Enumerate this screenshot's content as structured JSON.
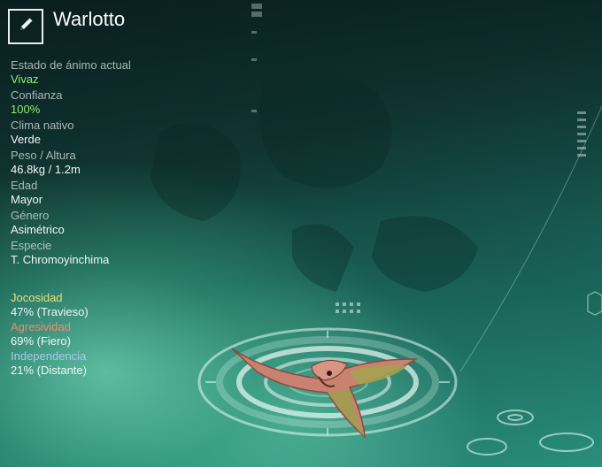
{
  "creature": {
    "name": "Warlotto"
  },
  "stats": [
    {
      "label": "Estado de ánimo actual",
      "value": "Vivaz",
      "highlight": true
    },
    {
      "label": "Confianza",
      "value": "100%",
      "highlight": true
    },
    {
      "label": "Clima nativo",
      "value": "Verde",
      "highlight": false
    },
    {
      "label": "Peso / Altura",
      "value": "46.8kg / 1.2m",
      "highlight": false
    },
    {
      "label": "Edad",
      "value": "Mayor",
      "highlight": false
    },
    {
      "label": "Género",
      "value": "Asimétrico",
      "highlight": false
    },
    {
      "label": "Especie",
      "value": "T. Chromoyinchima",
      "highlight": false
    }
  ],
  "traits": [
    {
      "label": "Jocosidad",
      "value": "47% (Travieso)",
      "color": "#e8e07a"
    },
    {
      "label": "Agresividad",
      "value": "69% (Fiero)",
      "color": "#f08a6a"
    },
    {
      "label": "Independencia",
      "value": "21% (Distante)",
      "color": "#a9c8f0"
    }
  ],
  "icons": {
    "edit": "pencil-icon"
  }
}
